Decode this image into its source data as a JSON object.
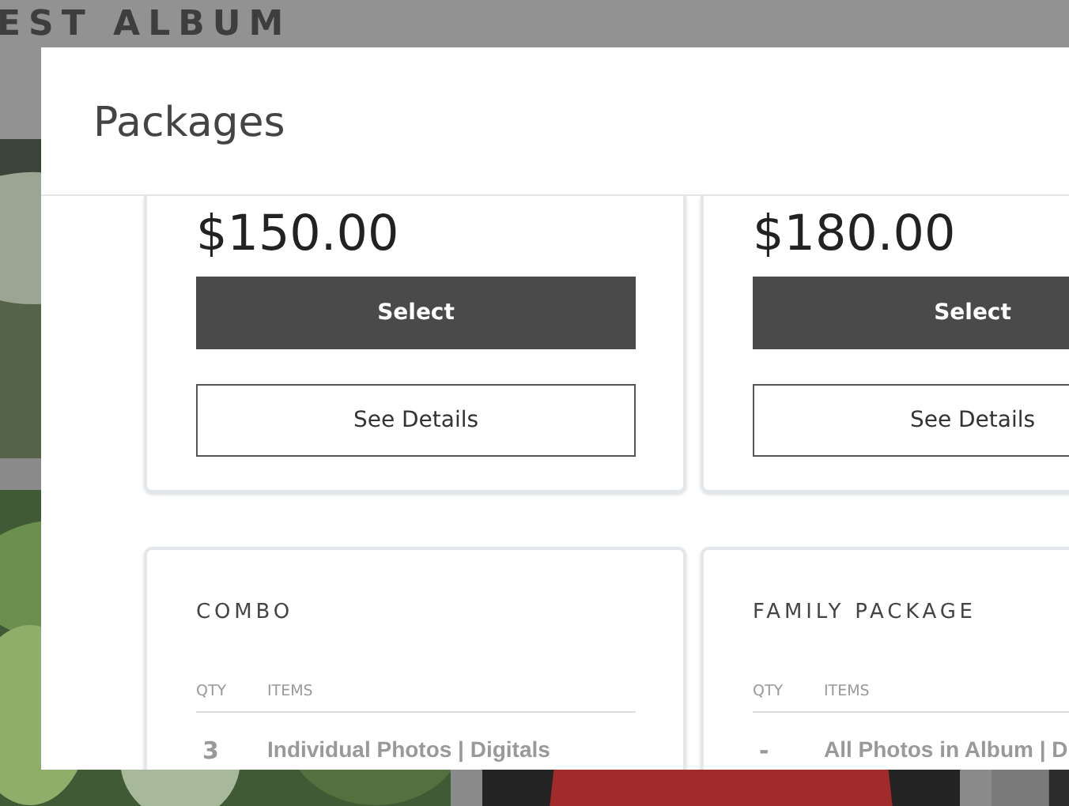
{
  "background": {
    "album_title": "EST ALBUM"
  },
  "modal": {
    "title": "Packages"
  },
  "packages": [
    {
      "kind": "offer",
      "price": "$150.00",
      "select_label": "Select",
      "details_label": "See Details"
    },
    {
      "kind": "offer",
      "price": "$180.00",
      "select_label": "Select",
      "details_label": "See Details"
    },
    {
      "kind": "contents",
      "name": "COMBO",
      "columns": [
        "QTY",
        "ITEMS"
      ],
      "rows": [
        {
          "qty": "3",
          "items": "Individual Photos | Digitals"
        }
      ]
    },
    {
      "kind": "contents",
      "name": "FAMILY PACKAGE",
      "columns": [
        "QTY",
        "ITEMS"
      ],
      "rows": [
        {
          "qty": "-",
          "items": "All Photos in Album | D"
        }
      ]
    }
  ]
}
